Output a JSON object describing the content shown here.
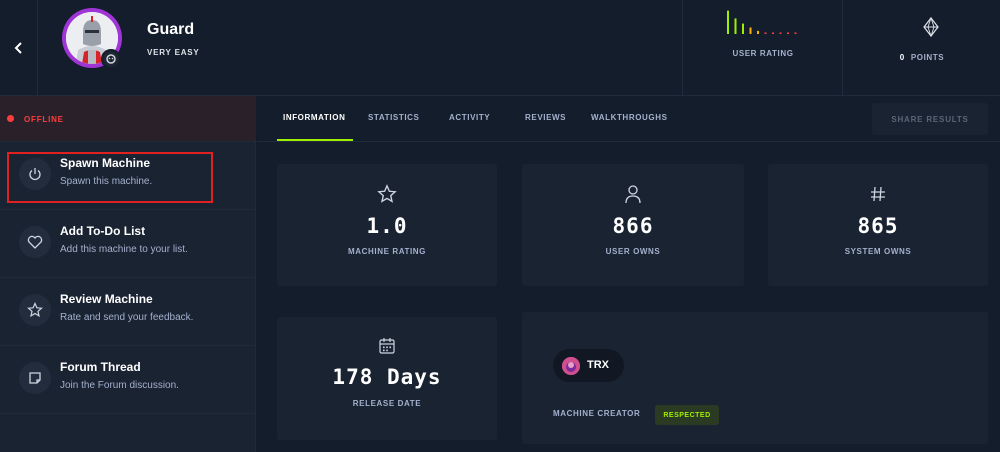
{
  "header": {
    "machine_name": "Guard",
    "difficulty": "VERY EASY",
    "rating_label": "USER RATING",
    "rating_bars": [
      0.9,
      0.6,
      0.4,
      0.25,
      0.12,
      0.06,
      0.06,
      0.06,
      0.06,
      0.06
    ],
    "points_value": "0",
    "points_label": "POINTS"
  },
  "sidebar": {
    "status": "OFFLINE",
    "actions": [
      {
        "title": "Spawn Machine",
        "subtitle": "Spawn this machine.",
        "icon": "power-icon"
      },
      {
        "title": "Add To-Do List",
        "subtitle": "Add this machine to your list.",
        "icon": "heart-icon"
      },
      {
        "title": "Review Machine",
        "subtitle": "Rate and send your feedback.",
        "icon": "star-icon"
      },
      {
        "title": "Forum Thread",
        "subtitle": "Join the Forum discussion.",
        "icon": "forum-icon"
      }
    ]
  },
  "tabs": [
    "INFORMATION",
    "STATISTICS",
    "ACTIVITY",
    "REVIEWS",
    "WALKTHROUGHS"
  ],
  "active_tab": "INFORMATION",
  "share_label": "SHARE RESULTS",
  "stats": [
    {
      "value": "1.0",
      "label": "MACHINE RATING",
      "icon": "star-icon"
    },
    {
      "value": "866",
      "label": "USER OWNS",
      "icon": "user-icon"
    },
    {
      "value": "865",
      "label": "SYSTEM OWNS",
      "icon": "hash-icon"
    }
  ],
  "release": {
    "value": "178 Days",
    "label": "RELEASE DATE",
    "icon": "calendar-icon"
  },
  "creator": {
    "name": "TRX",
    "label": "MACHINE CREATOR",
    "badge": "RESPECTED"
  },
  "colors": {
    "accent": "#9fef00",
    "offline": "#ff3e3e",
    "background": "#141d2b",
    "panel": "#1a2332",
    "highlight": "#e02121"
  }
}
